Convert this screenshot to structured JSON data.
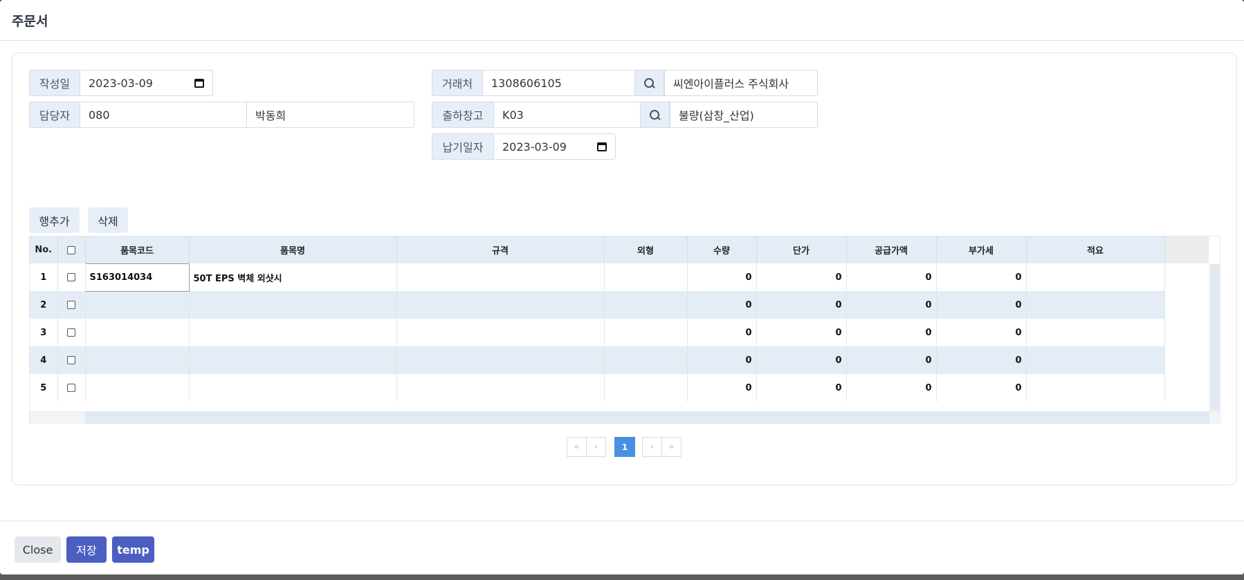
{
  "modal": {
    "title": "주문서"
  },
  "form": {
    "write_date": {
      "label": "작성일",
      "value": "2023-03-09"
    },
    "manager": {
      "label": "담당자",
      "code": "080",
      "name": "박동희"
    },
    "customer": {
      "label": "거래처",
      "code": "1308606105",
      "name": "씨엔아이플러스 주식회사"
    },
    "warehouse": {
      "label": "출하창고",
      "code": "K03",
      "name": "불량(삼창_산업)"
    },
    "delivery_date": {
      "label": "납기일자",
      "value": "2023-03-09"
    }
  },
  "grid_buttons": {
    "add_row": "행추가",
    "delete": "삭제"
  },
  "grid": {
    "columns": [
      "No.",
      "",
      "품목코드",
      "품목명",
      "규격",
      "외형",
      "수량",
      "단가",
      "공급가액",
      "부가세",
      "적요"
    ],
    "rows": [
      {
        "no": "1",
        "code": "S163014034",
        "name": "50T EPS 벽체 외샷시",
        "spec": "",
        "shape": "",
        "qty": "0",
        "price": "0",
        "supply": "0",
        "vat": "0",
        "memo": ""
      },
      {
        "no": "2",
        "code": "",
        "name": "",
        "spec": "",
        "shape": "",
        "qty": "0",
        "price": "0",
        "supply": "0",
        "vat": "0",
        "memo": ""
      },
      {
        "no": "3",
        "code": "",
        "name": "",
        "spec": "",
        "shape": "",
        "qty": "0",
        "price": "0",
        "supply": "0",
        "vat": "0",
        "memo": ""
      },
      {
        "no": "4",
        "code": "",
        "name": "",
        "spec": "",
        "shape": "",
        "qty": "0",
        "price": "0",
        "supply": "0",
        "vat": "0",
        "memo": ""
      },
      {
        "no": "5",
        "code": "",
        "name": "",
        "spec": "",
        "shape": "",
        "qty": "0",
        "price": "0",
        "supply": "0",
        "vat": "0",
        "memo": ""
      }
    ]
  },
  "pagination": {
    "first": "«",
    "prev": "‹",
    "current": "1",
    "next": "›",
    "last": "»"
  },
  "footer": {
    "close": "Close",
    "save": "저장",
    "temp": "temp"
  },
  "colors": {
    "primary": "#4a5fc1",
    "header_bg": "#e4ecf5",
    "active_page": "#4a90e2"
  }
}
